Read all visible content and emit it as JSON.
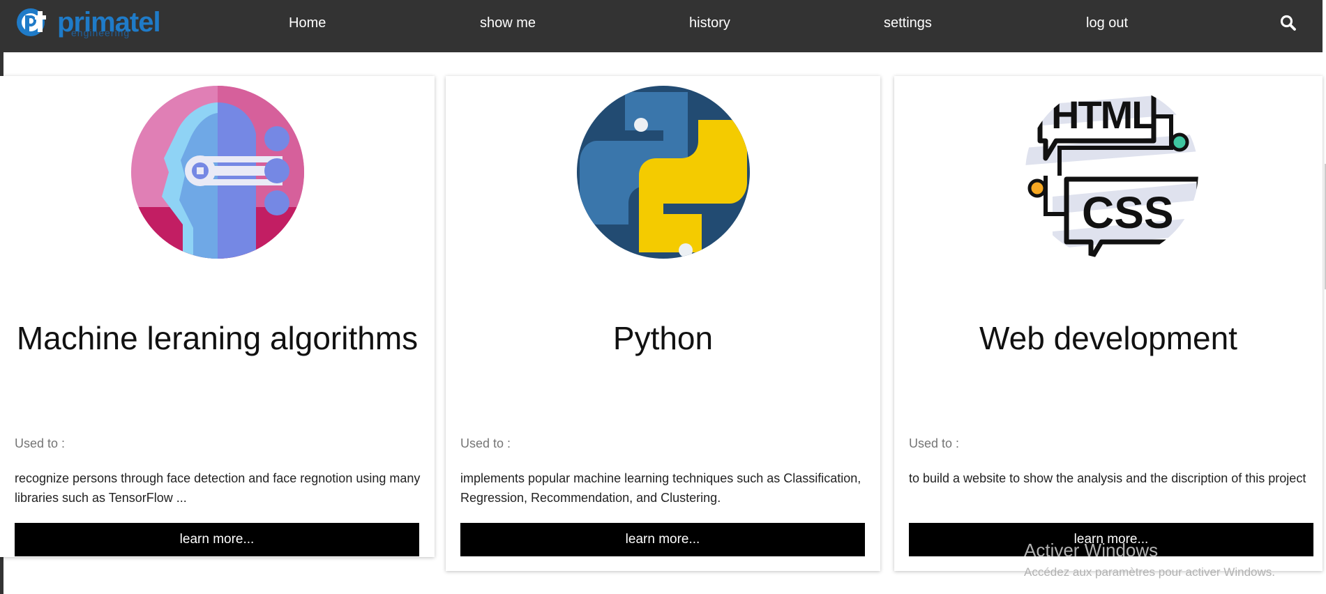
{
  "brand": {
    "logo_text": "primatel",
    "logo_sub": "engineering",
    "colors": {
      "navbar": "#333333",
      "logo_blue": "#1f7bc8",
      "button": "#000000"
    }
  },
  "nav": {
    "items": [
      {
        "label": "Home"
      },
      {
        "label": "show me"
      },
      {
        "label": "history"
      },
      {
        "label": "settings"
      },
      {
        "label": "log out"
      }
    ],
    "search_icon": "search-icon"
  },
  "cards": [
    {
      "title": "Machine leraning algorithms",
      "used_label": "Used to :",
      "description": "recognize persons through face detection and face regnotion using many libraries such as TensorFlow ...",
      "button_label": "learn more...",
      "image": "ai-head-icon"
    },
    {
      "title": "Python",
      "used_label": "Used to :",
      "description": "implements popular machine learning techniques such as Classification, Regression, Recommendation, and Clustering.",
      "button_label": "learn more...",
      "image": "python-logo-icon"
    },
    {
      "title": "Web development",
      "used_label": "Used to :",
      "description": "to build a website to show the analysis and the discription of this project",
      "button_label": "learn more...",
      "image": "html-css-icon"
    }
  ],
  "watermark": {
    "title": "Activer Windows",
    "subtitle": "Accédez aux paramètres pour activer Windows."
  }
}
